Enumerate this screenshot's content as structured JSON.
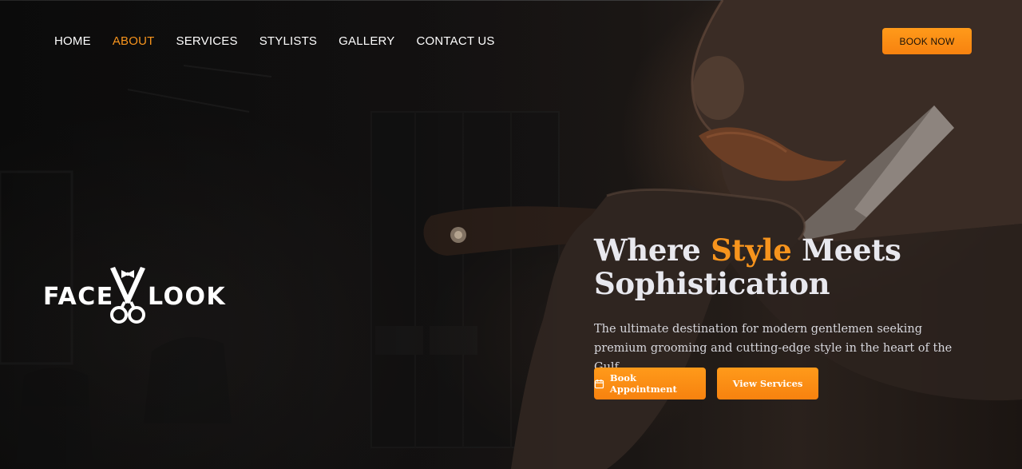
{
  "nav": {
    "items": [
      {
        "label": "HOME",
        "active": false
      },
      {
        "label": "ABOUT",
        "active": true
      },
      {
        "label": "SERVICES",
        "active": false
      },
      {
        "label": "STYLISTS",
        "active": false
      },
      {
        "label": "GALLERY",
        "active": false
      },
      {
        "label": "CONTACT US",
        "active": false
      }
    ],
    "cta_label": "BOOK NOW"
  },
  "logo": {
    "left_word": "FACE",
    "right_word": "LOOK",
    "mark_icon": "scissors-bowtie-icon"
  },
  "hero": {
    "headline_part1": "Where ",
    "headline_accent": "Style",
    "headline_part2": " Meets Sophistication",
    "subtext": "The ultimate destination for modern gentlemen seeking premium grooming and cutting-edge style in the heart of the Gulf.",
    "primary_button": "Book Appointment",
    "primary_button_icon": "calendar-icon",
    "secondary_button": "View Services"
  },
  "colors": {
    "accent": "#f7941d",
    "background": "#0a0a0a",
    "text": "#ffffff"
  }
}
